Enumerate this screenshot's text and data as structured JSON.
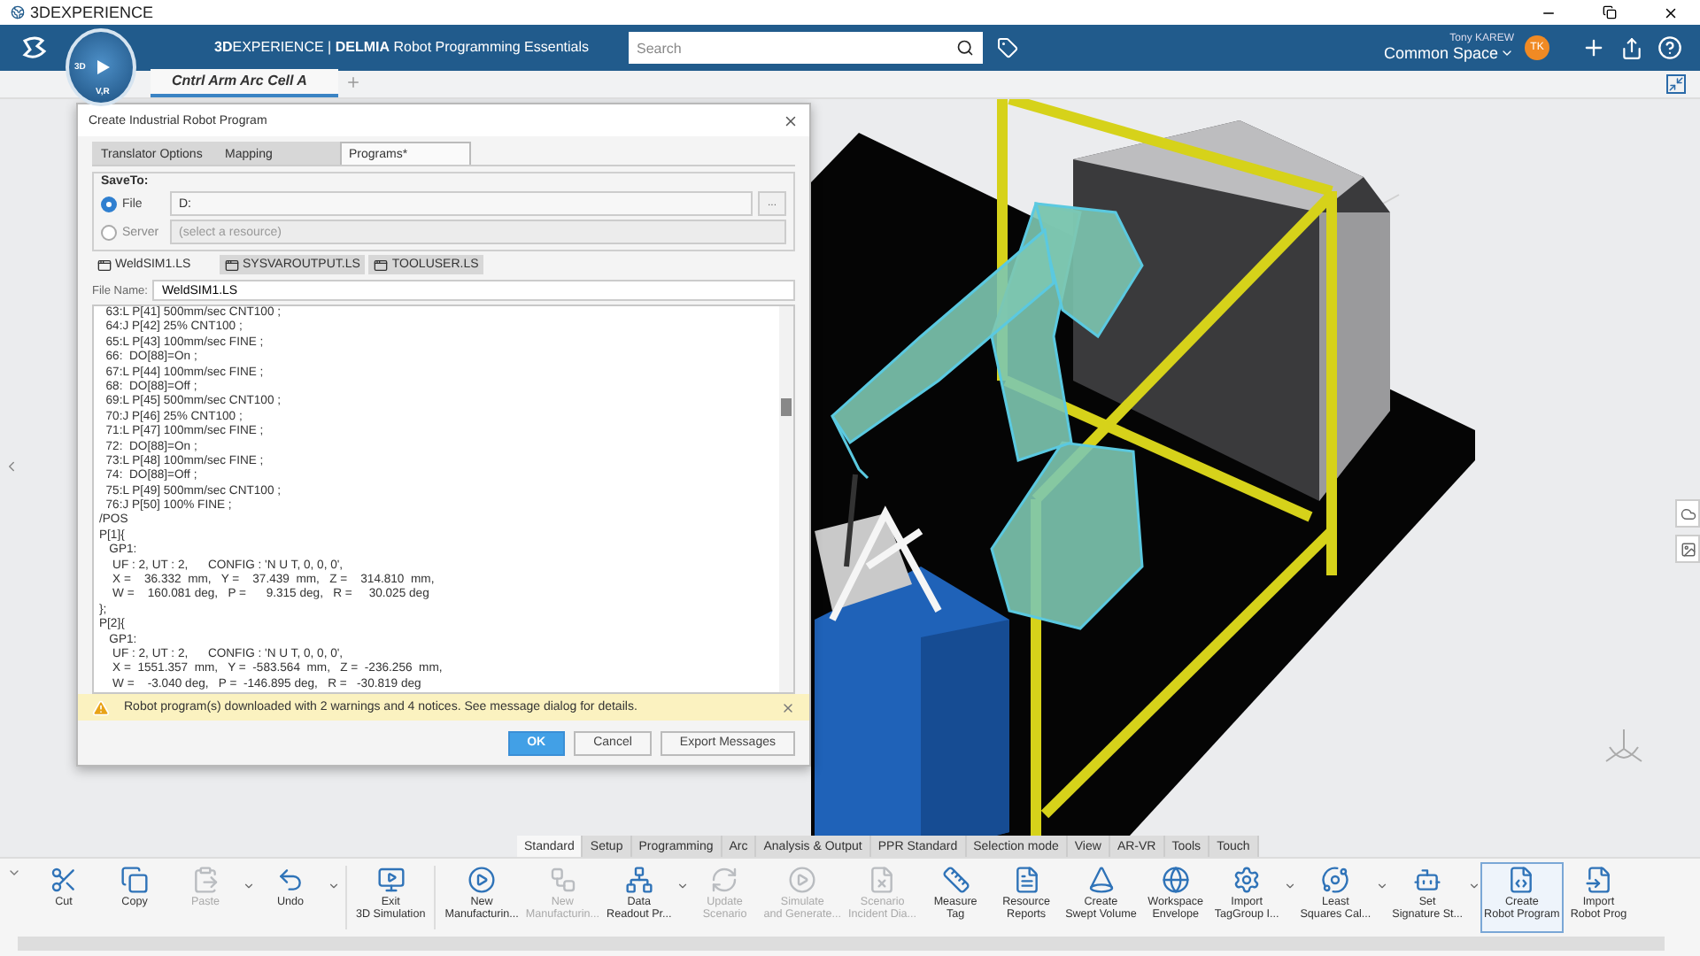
{
  "window": {
    "title": "3DEXPERIENCE"
  },
  "header": {
    "brand": "**3D**EXPERIENCE | **DELMIA** Robot Programming Essentials",
    "compass": {
      "left": "3D",
      "bottom": "V,R"
    },
    "search": {
      "placeholder": "Search"
    },
    "user": "Tony KAREW",
    "space": "Common Space",
    "avatar": "TK"
  },
  "tabs": [
    {
      "label": "Cntrl Arm Arc Cell A",
      "selected": true
    }
  ],
  "dialog": {
    "title": "Create Industrial Robot Program",
    "tabs": [
      {
        "label": "Translator Options",
        "selected": false
      },
      {
        "label": "Mapping",
        "selected": false
      },
      {
        "label": "Programs*",
        "selected": true
      }
    ],
    "save_to": {
      "legend": "SaveTo:",
      "browse": "...",
      "options": [
        {
          "label": "File",
          "selected": true,
          "disabled": false,
          "value": "D:"
        },
        {
          "label": "Server",
          "selected": false,
          "disabled": true,
          "placeholder": "(select a resource)"
        }
      ]
    },
    "file_tabs": [
      {
        "label": "WeldSIM1.LS",
        "selected": true
      },
      {
        "label": "SYSVAROUTPUT.LS",
        "selected": false
      },
      {
        "label": "TOOLUSER.LS",
        "selected": false
      }
    ],
    "file_name": {
      "label": "File Name:",
      "value": "WeldSIM1.LS"
    },
    "code": [
      "  63:L P[41] 500mm/sec CNT100 ;",
      "  64:J P[42] 25% CNT100 ;",
      "  65:L P[43] 100mm/sec FINE ;",
      "  66:  DO[88]=On ;",
      "  67:L P[44] 100mm/sec FINE ;",
      "  68:  DO[88]=Off ;",
      "  69:L P[45] 500mm/sec CNT100 ;",
      "  70:J P[46] 25% CNT100 ;",
      "  71:L P[47] 100mm/sec FINE ;",
      "  72:  DO[88]=On ;",
      "  73:L P[48] 100mm/sec FINE ;",
      "  74:  DO[88]=Off ;",
      "  75:L P[49] 500mm/sec CNT100 ;",
      "  76:J P[50] 100% FINE ;",
      "/POS",
      "P[1]{",
      "   GP1:",
      "    UF : 2, UT : 2,      CONFIG : 'N U T, 0, 0, 0',",
      "    X =    36.332  mm,   Y =    37.439  mm,   Z =    314.810  mm,",
      "    W =    160.081 deg,   P =      9.315 deg,   R =     30.025 deg",
      "};",
      "P[2]{",
      "   GP1:",
      "    UF : 2, UT : 2,      CONFIG : 'N U T, 0, 0, 0',",
      "    X =  1551.357  mm,   Y =  -583.564  mm,   Z =  -236.256  mm,",
      "    W =    -3.040 deg,   P =  -146.895 deg,   R =   -30.819 deg"
    ],
    "message": "Robot program(s) downloaded with 2 warnings and 4 notices.  See message dialog for details.",
    "buttons": [
      {
        "label": "OK",
        "kind": "primary"
      },
      {
        "label": "Cancel",
        "kind": "normal"
      },
      {
        "label": "Export Messages",
        "kind": "normal"
      }
    ]
  },
  "ribbon": {
    "tabs": [
      {
        "label": "Standard",
        "selected": true
      },
      {
        "label": "Setup",
        "selected": false
      },
      {
        "label": "Programming",
        "selected": false
      },
      {
        "label": "Arc",
        "selected": false
      },
      {
        "label": "Analysis & Output",
        "selected": false
      },
      {
        "label": "PPR Standard",
        "selected": false
      },
      {
        "label": "Selection mode",
        "selected": false
      },
      {
        "label": "View",
        "selected": false
      },
      {
        "label": "AR-VR",
        "selected": false
      },
      {
        "label": "Tools",
        "selected": false
      },
      {
        "label": "Touch",
        "selected": false
      }
    ],
    "tools": [
      {
        "lines": [
          "Cut"
        ],
        "disabled": false,
        "dropdown": false,
        "selected": false,
        "separator": false
      },
      {
        "lines": [
          "Copy"
        ],
        "disabled": false,
        "dropdown": false,
        "selected": false,
        "separator": false
      },
      {
        "lines": [
          "Paste"
        ],
        "disabled": true,
        "dropdown": true,
        "selected": false,
        "separator": false
      },
      {
        "lines": [
          "Undo"
        ],
        "disabled": false,
        "dropdown": true,
        "selected": false,
        "separator": true
      },
      {
        "lines": [
          "Exit",
          "3D Simulation"
        ],
        "disabled": false,
        "dropdown": false,
        "selected": false,
        "separator": true
      },
      {
        "lines": [
          "New",
          "Manufacturin..."
        ],
        "disabled": false,
        "dropdown": false,
        "selected": false,
        "separator": false
      },
      {
        "lines": [
          "New",
          "Manufacturin..."
        ],
        "disabled": true,
        "dropdown": false,
        "selected": false,
        "separator": false
      },
      {
        "lines": [
          "Data",
          "Readout Pr..."
        ],
        "disabled": false,
        "dropdown": true,
        "selected": false,
        "separator": false
      },
      {
        "lines": [
          "Update",
          "Scenario"
        ],
        "disabled": true,
        "dropdown": false,
        "selected": false,
        "separator": false
      },
      {
        "lines": [
          "Simulate",
          "and Generate..."
        ],
        "disabled": true,
        "dropdown": false,
        "selected": false,
        "separator": false
      },
      {
        "lines": [
          "Scenario",
          "Incident Dia..."
        ],
        "disabled": true,
        "dropdown": false,
        "selected": false,
        "separator": false
      },
      {
        "lines": [
          "Measure",
          "Tag"
        ],
        "disabled": false,
        "dropdown": false,
        "selected": false,
        "separator": false
      },
      {
        "lines": [
          "Resource",
          "Reports"
        ],
        "disabled": false,
        "dropdown": false,
        "selected": false,
        "separator": false
      },
      {
        "lines": [
          "Create",
          "Swept Volume"
        ],
        "disabled": false,
        "dropdown": false,
        "selected": false,
        "separator": false
      },
      {
        "lines": [
          "Workspace",
          "Envelope"
        ],
        "disabled": false,
        "dropdown": false,
        "selected": false,
        "separator": false
      },
      {
        "lines": [
          "Import",
          "TagGroup I..."
        ],
        "disabled": false,
        "dropdown": true,
        "selected": false,
        "separator": false
      },
      {
        "lines": [
          "Least",
          "Squares Cal..."
        ],
        "disabled": false,
        "dropdown": true,
        "selected": false,
        "separator": false
      },
      {
        "lines": [
          "Set",
          "Signature St..."
        ],
        "disabled": false,
        "dropdown": true,
        "selected": false,
        "separator": false
      },
      {
        "lines": [
          "Create",
          "Robot Program"
        ],
        "disabled": false,
        "dropdown": false,
        "selected": true,
        "separator": false
      },
      {
        "lines": [
          "Import",
          "Robot Prog"
        ],
        "disabled": false,
        "dropdown": false,
        "selected": false,
        "separator": false
      }
    ]
  }
}
